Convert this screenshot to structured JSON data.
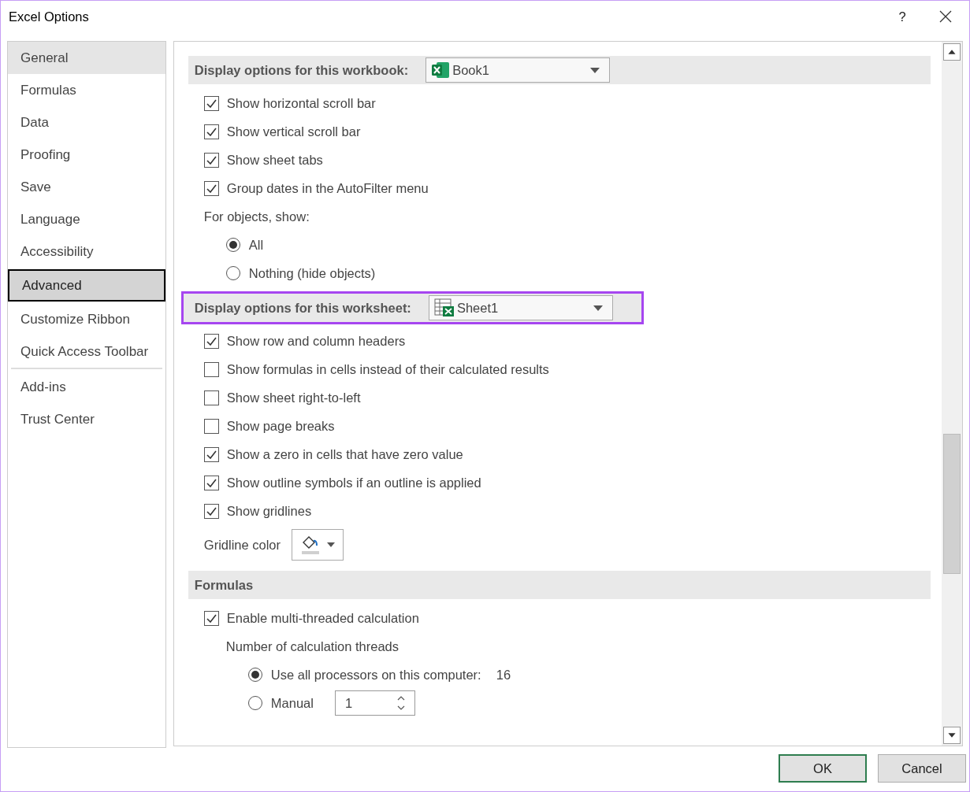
{
  "window": {
    "title": "Excel Options",
    "help": "?"
  },
  "sidebar": {
    "groups": [
      [
        {
          "label": "General",
          "selected": false,
          "hovered": true
        },
        {
          "label": "Formulas",
          "selected": false,
          "hovered": false
        },
        {
          "label": "Data",
          "selected": false,
          "hovered": false
        },
        {
          "label": "Proofing",
          "selected": false,
          "hovered": false
        },
        {
          "label": "Save",
          "selected": false,
          "hovered": false
        },
        {
          "label": "Language",
          "selected": false,
          "hovered": false
        },
        {
          "label": "Accessibility",
          "selected": false,
          "hovered": false
        },
        {
          "label": "Advanced",
          "selected": true
        },
        {
          "label": "Customize Ribbon",
          "selected": false,
          "hovered": false
        },
        {
          "label": "Quick Access Toolbar",
          "selected": false,
          "hovered": false
        }
      ],
      [
        {
          "label": "Add-ins",
          "selected": false,
          "hovered": false
        },
        {
          "label": "Trust Center",
          "selected": false,
          "hovered": false
        }
      ]
    ]
  },
  "sections": [
    {
      "title": "Display options for this workbook:",
      "highlighted": false,
      "dropdown": {
        "kind": "workbook",
        "value": "Book1"
      },
      "rows": [
        {
          "kind": "checkbox",
          "label": "Show horizontal scroll bar",
          "checked": true
        },
        {
          "kind": "checkbox",
          "label": "Show vertical scroll bar",
          "checked": true
        },
        {
          "kind": "checkbox",
          "label": "Show sheet tabs",
          "checked": true
        },
        {
          "kind": "checkbox",
          "label": "Group dates in the AutoFilter menu",
          "checked": true
        },
        {
          "kind": "label",
          "label": "For objects, show:",
          "children": [
            {
              "kind": "radio",
              "label": "All",
              "selected": true
            },
            {
              "kind": "radio",
              "label": "Nothing (hide objects)",
              "selected": false
            }
          ]
        }
      ]
    },
    {
      "title": "Display options for this worksheet:",
      "highlighted": true,
      "dropdown": {
        "kind": "worksheet",
        "value": "Sheet1"
      },
      "rows": [
        {
          "kind": "checkbox",
          "label": "Show row and column headers",
          "checked": true
        },
        {
          "kind": "checkbox",
          "label": "Show formulas in cells instead of their calculated results",
          "checked": false
        },
        {
          "kind": "checkbox",
          "label": "Show sheet right-to-left",
          "checked": false
        },
        {
          "kind": "checkbox",
          "label": "Show page breaks",
          "checked": false
        },
        {
          "kind": "checkbox",
          "label": "Show a zero in cells that have zero value",
          "checked": true
        },
        {
          "kind": "checkbox",
          "label": "Show outline symbols if an outline is applied",
          "checked": true
        },
        {
          "kind": "checkbox",
          "label": "Show gridlines",
          "checked": true
        },
        {
          "kind": "color",
          "label": "Gridline color"
        }
      ]
    },
    {
      "title": "Formulas",
      "highlighted": false,
      "rows": [
        {
          "kind": "checkbox",
          "label": "Enable multi-threaded calculation",
          "checked": true,
          "children": [
            {
              "kind": "label",
              "label": "Number of calculation threads",
              "children": [
                {
                  "kind": "radio",
                  "label": "Use all processors on this computer:",
                  "selected": true,
                  "value": "16"
                },
                {
                  "kind": "radio",
                  "label": "Manual",
                  "selected": false,
                  "field": "1"
                }
              ]
            }
          ]
        }
      ]
    }
  ],
  "buttons": [
    {
      "label": "OK",
      "default": true
    },
    {
      "label": "Cancel",
      "default": false
    }
  ]
}
